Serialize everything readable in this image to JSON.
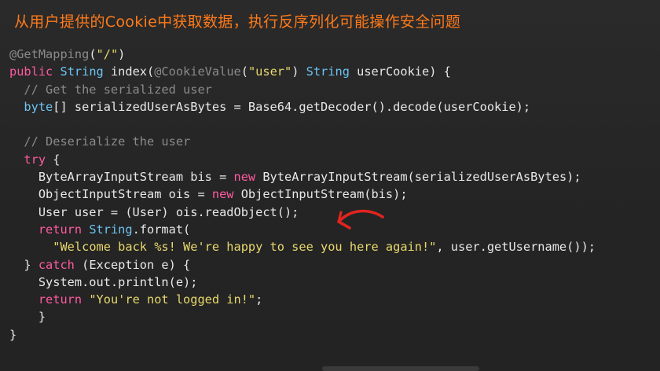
{
  "title": "从用户提供的Cookie中获取数据，执行反序列化可能操作安全问题",
  "code": {
    "line1": {
      "a": "@GetMapping",
      "b": "(",
      "c": "\"/\"",
      "d": ")"
    },
    "line2": {
      "a": "public",
      "b": " ",
      "c": "String",
      "d": " index(",
      "e": "@CookieValue",
      "f": "(",
      "g": "\"user\"",
      "h": ") ",
      "i": "String",
      "j": " userCookie) {"
    },
    "line3": {
      "a": "  // Get the serialized user"
    },
    "line4": {
      "a": "  ",
      "b": "byte",
      "c": "[] serializedUserAsBytes = Base64.getDecoder().decode(userCookie);"
    },
    "line5": {
      "a": ""
    },
    "line6": {
      "a": "  // Deserialize the user"
    },
    "line7": {
      "a": "  ",
      "b": "try",
      "c": " {"
    },
    "line8": {
      "a": "    ByteArrayInputStream bis = ",
      "b": "new",
      "c": " ByteArrayInputStream(serializedUserAsBytes);"
    },
    "line9": {
      "a": "    ObjectInputStream ois = ",
      "b": "new",
      "c": " ObjectInputStream(bis);"
    },
    "line10": {
      "a": "    User user = (User) ois.readObject();"
    },
    "line11": {
      "a": "    ",
      "b": "return",
      "c": " ",
      "d": "String",
      "e": ".format("
    },
    "line12": {
      "a": "      ",
      "b": "\"Welcome back %s! We're happy to see you here again!\"",
      "c": ", user.getUsername());"
    },
    "line13": {
      "a": "  } ",
      "b": "catch",
      "c": " (Exception e) {"
    },
    "line14": {
      "a": "    System.out.println(e);"
    },
    "line15": {
      "a": "    ",
      "b": "return",
      "c": " ",
      "d": "\"You're not logged in!\"",
      "e": ";"
    },
    "line16": {
      "a": "    }"
    },
    "line17": {
      "a": "}"
    }
  },
  "colors": {
    "title": "#ff7a1a",
    "keyword": "#ff5aa0",
    "type": "#6cc3f0",
    "string": "#e8d86c",
    "comment": "#8a8a8a",
    "plain": "#e8e8e8",
    "arrow": "#e0241f",
    "background": "#242424"
  },
  "icons": {
    "annotation_arrow": "red-curved-arrow-icon"
  }
}
